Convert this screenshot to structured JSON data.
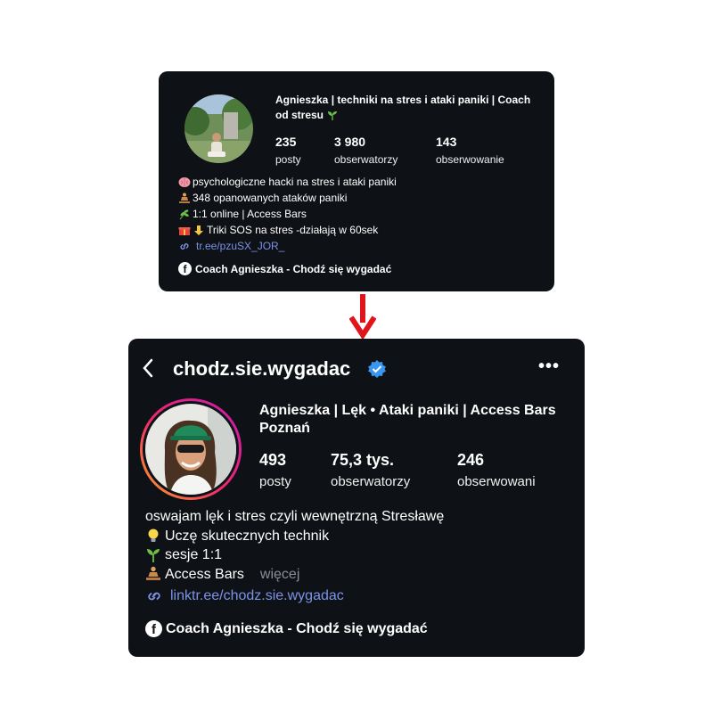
{
  "before": {
    "display_name": "Agnieszka | techniki na stres i ataki paniki | Coach od stresu",
    "stats": [
      {
        "value": "235",
        "label": "posty"
      },
      {
        "value": "3 980",
        "label": "obserwatorzy"
      },
      {
        "value": "143",
        "label": "obserwowanie"
      }
    ],
    "bio": [
      {
        "icon": "brain-icon",
        "text": "psychologiczne hacki na stres i ataki paniki"
      },
      {
        "icon": "meditation-icon",
        "text": "348 opanowanych ataków paniki"
      },
      {
        "icon": "herb-icon",
        "text": "1:1 online | Access Bars"
      },
      {
        "icon": "gift-pointing-icon",
        "text": "Triki SOS na stres -działają w 60sek"
      }
    ],
    "link": "tr.ee/pzuSX_JOR_",
    "facebook_page": "Coach Agnieszka - Chodź się wygadać"
  },
  "after": {
    "handle": "chodz.sie.wygadac",
    "display_name": "Agnieszka  | Lęk • Ataki paniki | Access Bars Poznań",
    "stats": [
      {
        "value": "493",
        "label": "posty"
      },
      {
        "value": "75,3 tys.",
        "label": "obserwatorzy"
      },
      {
        "value": "246",
        "label": "obserwowani"
      }
    ],
    "bio": [
      {
        "icon": "",
        "text": "oswajam lęk i stres czyli wewnętrzną Stresławę"
      },
      {
        "icon": "lightbulb-icon",
        "text": "Uczę skutecznych technik"
      },
      {
        "icon": "seedling-icon",
        "text": "sesje 1:1"
      },
      {
        "icon": "meditation-icon",
        "text": "Access Bars"
      }
    ],
    "more_label": "więcej",
    "link": "linktr.ee/chodz.sie.wygadac",
    "facebook_page": "Coach Agnieszka - Chodź się wygadać"
  },
  "colors": {
    "card_bg": "#0e1116",
    "link": "#7c93e8",
    "arrow": "#e0151b",
    "verified": "#3897f0",
    "muted": "#8b8e95"
  }
}
